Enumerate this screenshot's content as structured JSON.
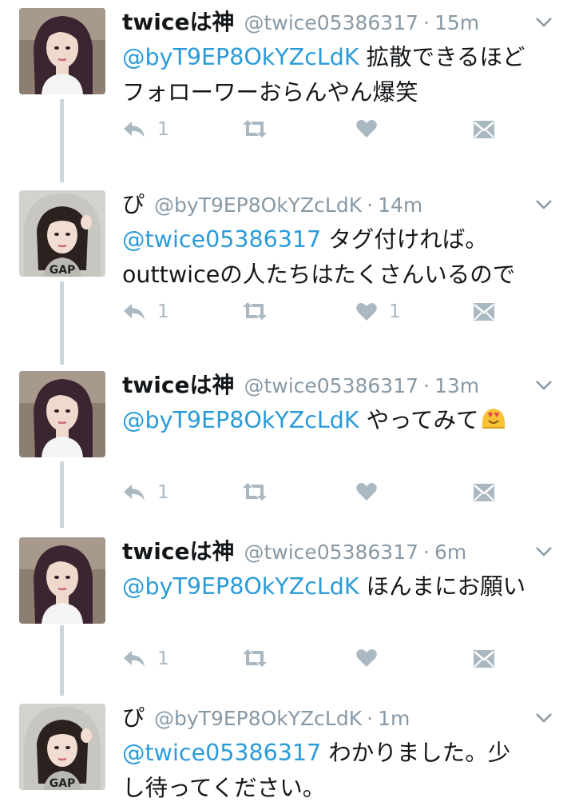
{
  "tweets": [
    {
      "name": "twiceは神",
      "handle": "@twice05386317",
      "time": "15m",
      "mention": "@byT9EP8OkYZcLdK",
      "text_line1": "拡散できるほど",
      "text_line2": "フォローワーおらんやん爆笑",
      "reply_count": "1",
      "like_count": "",
      "avatar": "dark-haired-woman"
    },
    {
      "name": "ぴ",
      "handle": "@byT9EP8OkYZcLdK",
      "time": "14m",
      "mention": "@twice05386317",
      "text_line1": "タグ付ければ。",
      "text_line2": "outtwiceの人たちはたくさんいるので",
      "reply_count": "1",
      "like_count": "1",
      "avatar": "woman-in-hoodie"
    },
    {
      "name": "twiceは神",
      "handle": "@twice05386317",
      "time": "13m",
      "mention": "@byT9EP8OkYZcLdK",
      "text_line1": "やってみて",
      "text_line2": "",
      "reply_count": "1",
      "like_count": "",
      "avatar": "dark-haired-woman",
      "emoji": "heart-eyes-emoji"
    },
    {
      "name": "twiceは神",
      "handle": "@twice05386317",
      "time": "6m",
      "mention": "@byT9EP8OkYZcLdK",
      "text_line1": "ほんまにお願い",
      "text_line2": "",
      "reply_count": "1",
      "like_count": "",
      "avatar": "dark-haired-woman"
    },
    {
      "name": "ぴ",
      "handle": "@byT9EP8OkYZcLdK",
      "time": "1m",
      "mention": "@twice05386317",
      "text_line1": "わかりました。少",
      "text_line2": "し待ってください。",
      "reply_count": "",
      "like_count": "",
      "avatar": "woman-in-hoodie"
    }
  ],
  "separator": "·",
  "colors": {
    "mention": "#2b9bd8",
    "meta": "#8899a6",
    "action": "#aab8c2",
    "thread_line": "#ccd6dd"
  },
  "icons": [
    "reply-icon",
    "retweet-icon",
    "like-icon",
    "direct-message-icon",
    "chevron-down-icon"
  ]
}
